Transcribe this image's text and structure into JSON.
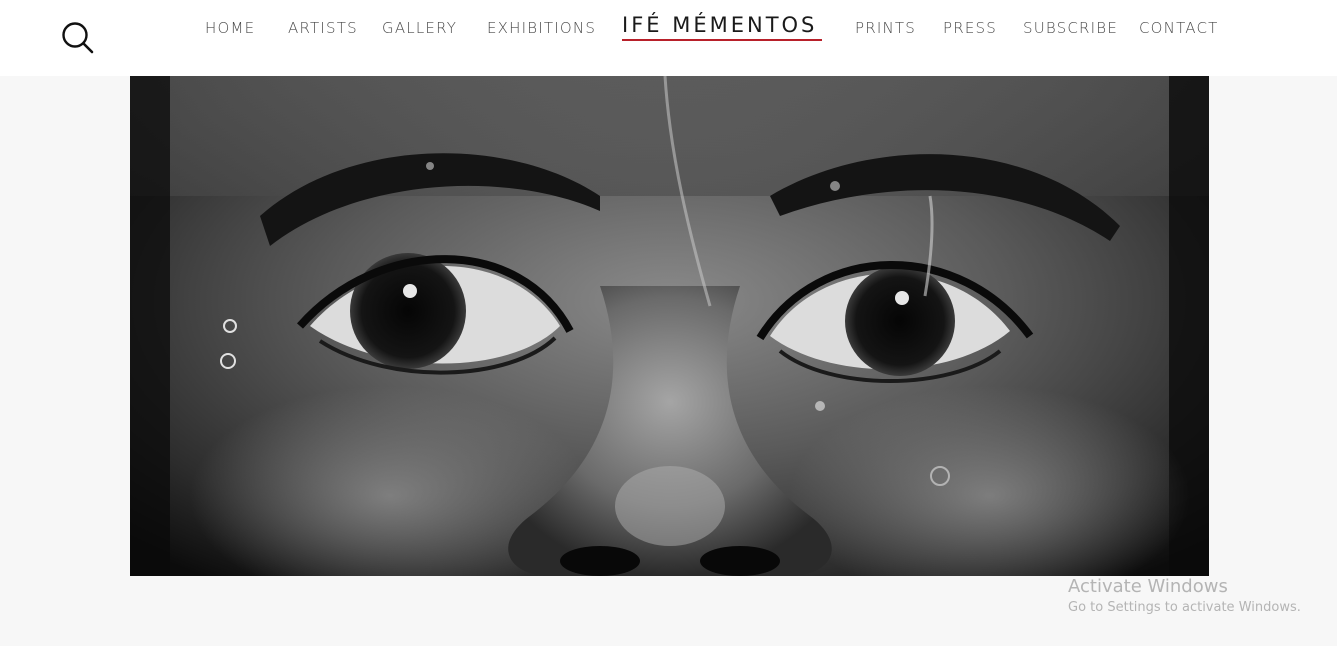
{
  "header": {
    "search_icon": "search-icon",
    "nav": {
      "home": "HOME",
      "artists": "ARTISTS",
      "gallery": "GALLERY",
      "exhibitions": "EXHIBITIONS",
      "brand": "IFÉ MÉMENTOS",
      "prints": "PRINTS",
      "press": "PRESS",
      "subscribe": "SUBSCRIBE",
      "contact": "CONTACT"
    },
    "brand_accent_color": "#b8202a"
  },
  "hero": {
    "image_style": "black-and-white close-up photograph of eyes and nose with water droplets"
  },
  "os_watermark": {
    "title": "Activate Windows",
    "subtitle": "Go to Settings to activate Windows."
  }
}
